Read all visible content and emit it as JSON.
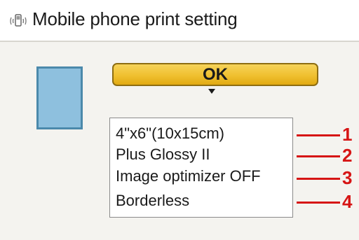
{
  "header": {
    "title": "Mobile phone print setting",
    "icon": "mobile-phone-icon"
  },
  "ok_button": {
    "label": "OK"
  },
  "settings": [
    {
      "label": "4\"x6\"(10x15cm)",
      "callout": "1"
    },
    {
      "label": "Plus Glossy II",
      "callout": "2"
    },
    {
      "label": "Image optimizer OFF",
      "callout": "3"
    },
    {
      "label": "Borderless",
      "callout": "4"
    }
  ],
  "colors": {
    "callout": "#d61515",
    "ok_button": "#f0c030",
    "preview": "#8ec0de"
  }
}
